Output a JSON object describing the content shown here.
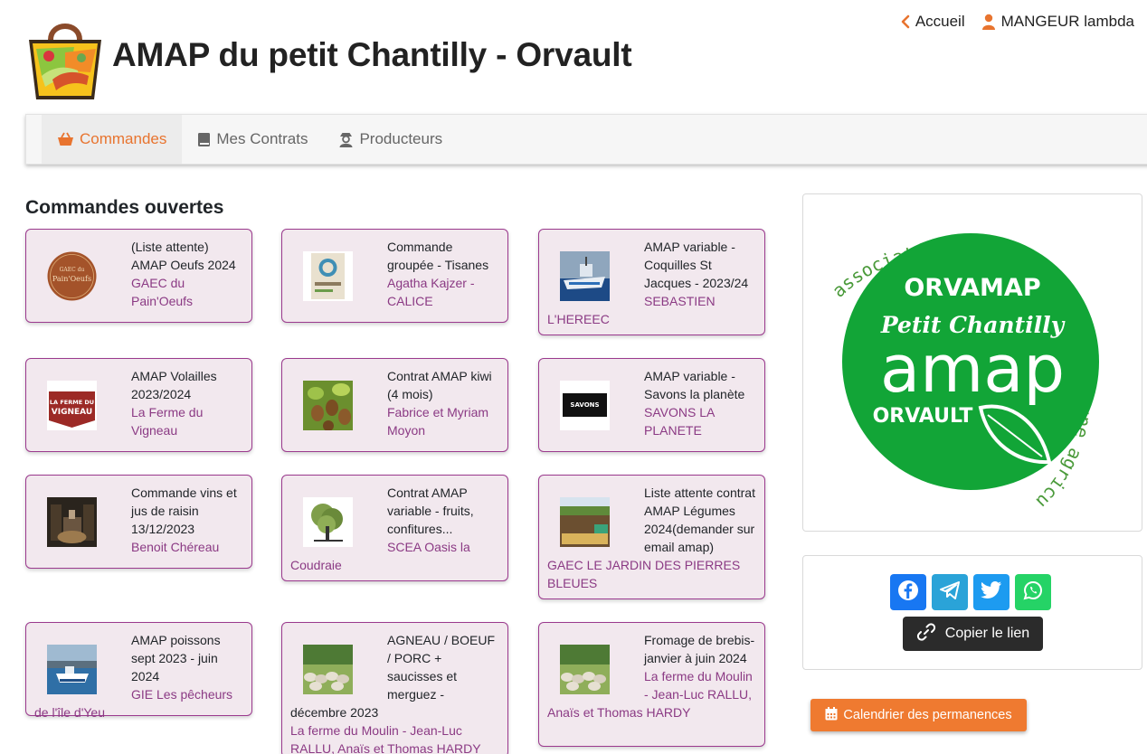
{
  "header": {
    "site_title": "AMAP du petit Chantilly - Orvault",
    "home_link": "Accueil",
    "user_link": "MANGEUR lambda"
  },
  "nav": {
    "items": [
      {
        "label": "Commandes",
        "icon": "basket-icon",
        "active": true
      },
      {
        "label": "Mes Contrats",
        "icon": "book-icon",
        "active": false
      },
      {
        "label": "Producteurs",
        "icon": "farmer-icon",
        "active": false
      }
    ]
  },
  "main": {
    "section_title": "Commandes ouvertes",
    "cards": [
      {
        "title": "(Liste attente) AMAP Oeufs 2024",
        "producer": "GAEC du Pain'Oeufs",
        "thumb": "pain-oeufs-logo"
      },
      {
        "title": "Commande groupée - Tisanes",
        "producer": "Agatha Kajzer - CALICE",
        "thumb": "tisane-package"
      },
      {
        "title": "AMAP variable - Coquilles St Jacques - 2023/24",
        "producer": "SEBASTIEN L'HEREEC",
        "thumb": "fishing-boat-photo"
      },
      {
        "title": "AMAP Volailles 2023/2024",
        "producer": "La Ferme du Vigneau",
        "thumb": "ferme-vigneau-logo"
      },
      {
        "title": "Contrat AMAP kiwi (4 mois)",
        "producer": "Fabrice et Myriam Moyon",
        "thumb": "kiwi-photo"
      },
      {
        "title": "AMAP variable - Savons la planète",
        "producer": "SAVONS LA PLANETE",
        "thumb": "savons-logo"
      },
      {
        "title": "Commande vins et jus de raisin 13/12/2023",
        "producer": "Benoit Chéreau",
        "thumb": "wine-cellar-photo"
      },
      {
        "title": "Contrat AMAP variable - fruits, confitures...",
        "producer": "SCEA Oasis la Coudraie",
        "thumb": "tree-logo"
      },
      {
        "title": "Liste attente contrat AMAP Légumes 2024(demander sur email amap)",
        "producer": "GAEC LE JARDIN DES PIERRES BLEUES",
        "thumb": "vegetable-field-photo"
      },
      {
        "title": "AMAP poissons sept 2023 - juin 2024",
        "producer": "GIE Les pêcheurs de l'île d'Yeu",
        "thumb": "harbour-boat-photo"
      },
      {
        "title": "AGNEAU / BOEUF / PORC + saucisses et merguez - décembre 2023",
        "producer": "La ferme du Moulin - Jean-Luc RALLU, Anaïs et Thomas HARDY",
        "thumb": "sheep-photo"
      },
      {
        "title": "Fromage de brebis- janvier à juin 2024",
        "producer": "La ferme du Moulin - Jean-Luc RALLU, Anaïs et Thomas HARDY",
        "thumb": "sheep-photo"
      }
    ],
    "thumb_text": {
      "pain_oeufs_1": "GAEC du",
      "pain_oeufs_2": "Pain'Oeufs",
      "vigneau_1": "LA FERME DU",
      "vigneau_2": "VIGNEAU",
      "savons_1": "SAVONS"
    }
  },
  "sidebar": {
    "logo_text": {
      "arc": "association pour le maintien d'une agriculture paysanne",
      "org": "ORVAMAP",
      "sub": "Petit Chantilly",
      "amap": "amap",
      "city": "ORVAULT"
    },
    "share_buttons": [
      {
        "icon": "facebook-icon",
        "color": "#1877f2"
      },
      {
        "icon": "telegram-icon",
        "color": "#2aa3d8"
      },
      {
        "icon": "twitter-icon",
        "color": "#1d9bf0"
      },
      {
        "icon": "whatsapp-icon",
        "color": "#25d366"
      }
    ],
    "copy_link": "Copier le lien",
    "calendar_button": "Calendrier des permanences"
  },
  "colors": {
    "accent": "#e8742f",
    "card_border": "#9b3a8e",
    "card_bg": "#f2e8ee",
    "producer_text": "#8b3a84",
    "logo_green": "#12a537"
  }
}
